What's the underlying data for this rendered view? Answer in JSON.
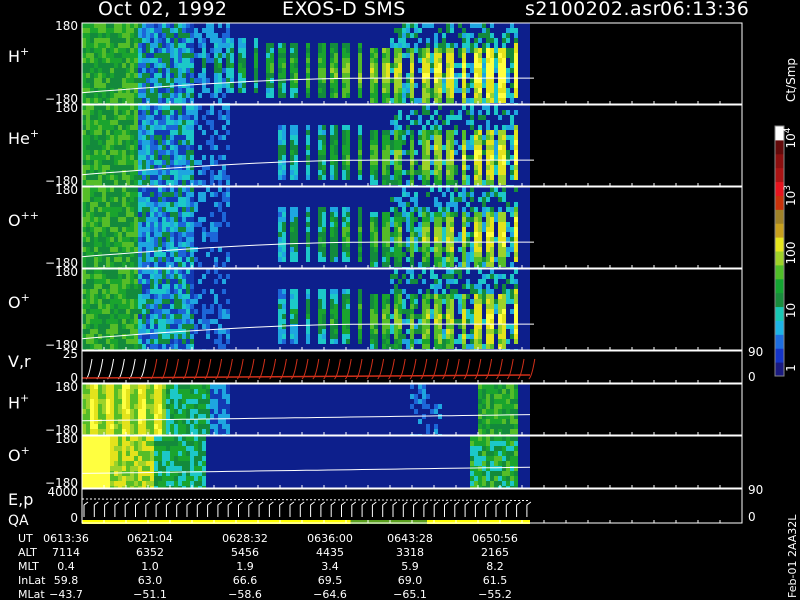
{
  "header": {
    "date": "Oct 02, 1992",
    "instrument": "EXOS-D SMS",
    "file": "s2100202.asr",
    "time": "06:13:36"
  },
  "colors": {
    "background": "#000000",
    "panel_background": "#0d1f8c",
    "line": "#ffffff",
    "vr_trace": "#d0301a"
  },
  "chart_data": {
    "type": "heatmap",
    "panels": [
      {
        "label": "H",
        "sup": "+",
        "ytop": "180",
        "ybot": "−180",
        "kind": "spectrogram",
        "start": 0.26,
        "strength": 1.0
      },
      {
        "label": "He",
        "sup": "+",
        "ytop": "180",
        "ybot": "−180",
        "kind": "spectrogram",
        "start": 0.42,
        "strength": 0.85
      },
      {
        "label": "O",
        "sup": "++",
        "ytop": "180",
        "ybot": "−180",
        "kind": "spectrogram",
        "start": 0.42,
        "strength": 0.8
      },
      {
        "label": "O",
        "sup": "+",
        "ytop": "180",
        "ybot": "−180",
        "kind": "spectrogram",
        "start": 0.42,
        "strength": 0.85
      },
      {
        "label": "V,r",
        "sup": "",
        "ytop": "25",
        "ybot": "0",
        "rtop": "90",
        "rbot": "0",
        "kind": "velocity"
      },
      {
        "label": "H",
        "sup": "+",
        "ytop": "180",
        "ybot": "−180",
        "kind": "lowenergy",
        "species": "H"
      },
      {
        "label": "O",
        "sup": "+",
        "ytop": "180",
        "ybot": "−180",
        "kind": "lowenergy",
        "species": "O"
      },
      {
        "label": "E,p",
        "label2": "QA",
        "sup": "",
        "ytop": "4000",
        "ybot": "0",
        "rtop": "90",
        "rbot": "0",
        "kind": "energy"
      }
    ],
    "colorbar": {
      "unit": "Ct/Smp",
      "labels": [
        {
          "text": "10",
          "sup": "4",
          "val": 4
        },
        {
          "text": "10",
          "sup": "3",
          "val": 3
        },
        {
          "text": "100",
          "sup": "",
          "val": 2
        },
        {
          "text": "10",
          "sup": "",
          "val": 1
        },
        {
          "text": "1",
          "sup": "",
          "val": 0
        }
      ],
      "colors": [
        "#1a1a80",
        "#1535c8",
        "#1e6ee0",
        "#1eb4e6",
        "#19c8b4",
        "#198c3c",
        "#14a532",
        "#50be28",
        "#a0d228",
        "#e6e61e",
        "#c8a01e",
        "#a08228",
        "#c8320a",
        "#e6141e",
        "#aa1414",
        "#8c0f0f",
        "#640a0a",
        "#ffffff"
      ]
    },
    "qa_bar": [
      {
        "from": 0.0,
        "to": 0.6,
        "color": "#ffff00"
      },
      {
        "from": 0.6,
        "to": 0.77,
        "color": "#5aa01e"
      },
      {
        "from": 0.77,
        "to": 1.0,
        "color": "#ffff00"
      }
    ],
    "footer": {
      "rows": [
        {
          "name": "UT",
          "values": [
            "0613:36",
            "0621:04",
            "0628:32",
            "0636:00",
            "0643:28",
            "0650:56"
          ]
        },
        {
          "name": "ALT",
          "values": [
            "7114",
            "6352",
            "5456",
            "4435",
            "3318",
            "2165"
          ]
        },
        {
          "name": "MLT",
          "values": [
            "0.4",
            "1.0",
            "1.9",
            "3.4",
            "5.9",
            "8.2"
          ]
        },
        {
          "name": "InLat",
          "values": [
            "59.8",
            "63.0",
            "66.6",
            "69.5",
            "69.0",
            "61.5"
          ]
        },
        {
          "name": "MLat",
          "values": [
            "−43.7",
            "−51.1",
            "−58.6",
            "−64.6",
            "−65.1",
            "−55.2"
          ]
        }
      ]
    },
    "side_label": "Feb-01  2AA32L"
  }
}
